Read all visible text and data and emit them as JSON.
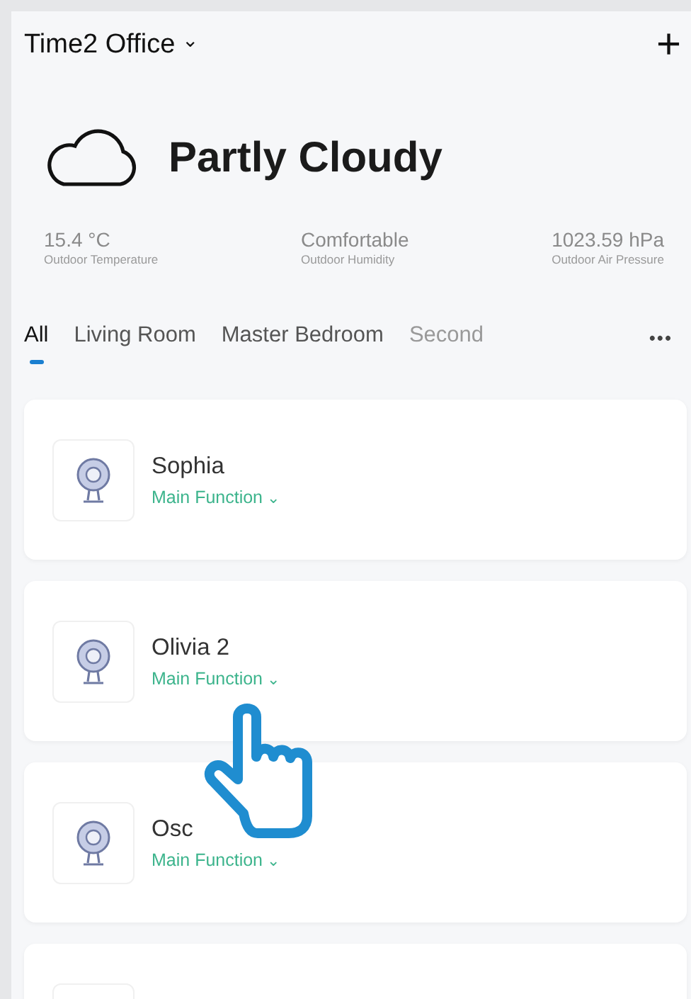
{
  "header": {
    "title": "Time2 Office",
    "caret": "⌄",
    "add": "+"
  },
  "weather": {
    "condition": "Partly Cloudy",
    "stats": [
      {
        "value": "15.4 °C",
        "label": "Outdoor Temperature"
      },
      {
        "value": "Comfortable",
        "label": "Outdoor Humidity"
      },
      {
        "value": "1023.59 hPa",
        "label": "Outdoor Air Pressure"
      }
    ]
  },
  "tabs": [
    {
      "label": "All",
      "selected": true
    },
    {
      "label": "Living Room",
      "selected": false
    },
    {
      "label": "Master Bedroom",
      "selected": false
    },
    {
      "label": "Second",
      "selected": false
    }
  ],
  "more": "•••",
  "devices": [
    {
      "kind": "full",
      "name": "Sophia",
      "function": "Main Function",
      "caret": "⌄"
    },
    {
      "kind": "full",
      "name": "Olivia 2",
      "function": "Main Function",
      "caret": "⌄"
    },
    {
      "kind": "full",
      "name": "Osc",
      "function": "Main Function",
      "caret": "⌄"
    },
    {
      "kind": "cut"
    }
  ]
}
